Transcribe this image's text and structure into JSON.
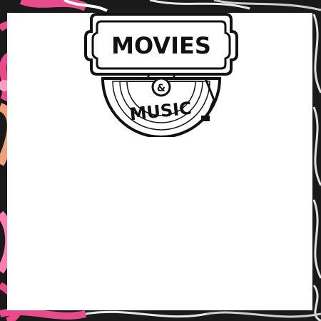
{
  "logo": {
    "line1": "MOVIES",
    "line2": "&",
    "line3": "MUSIC",
    "stroke_color": "#111111",
    "fill_color": "#ffffff"
  },
  "background": {
    "description_colors": [
      "#111111",
      "#e94b8a",
      "#ff7fb0",
      "#f0a07a",
      "#e8e8e8",
      "#c8c8c8"
    ]
  }
}
